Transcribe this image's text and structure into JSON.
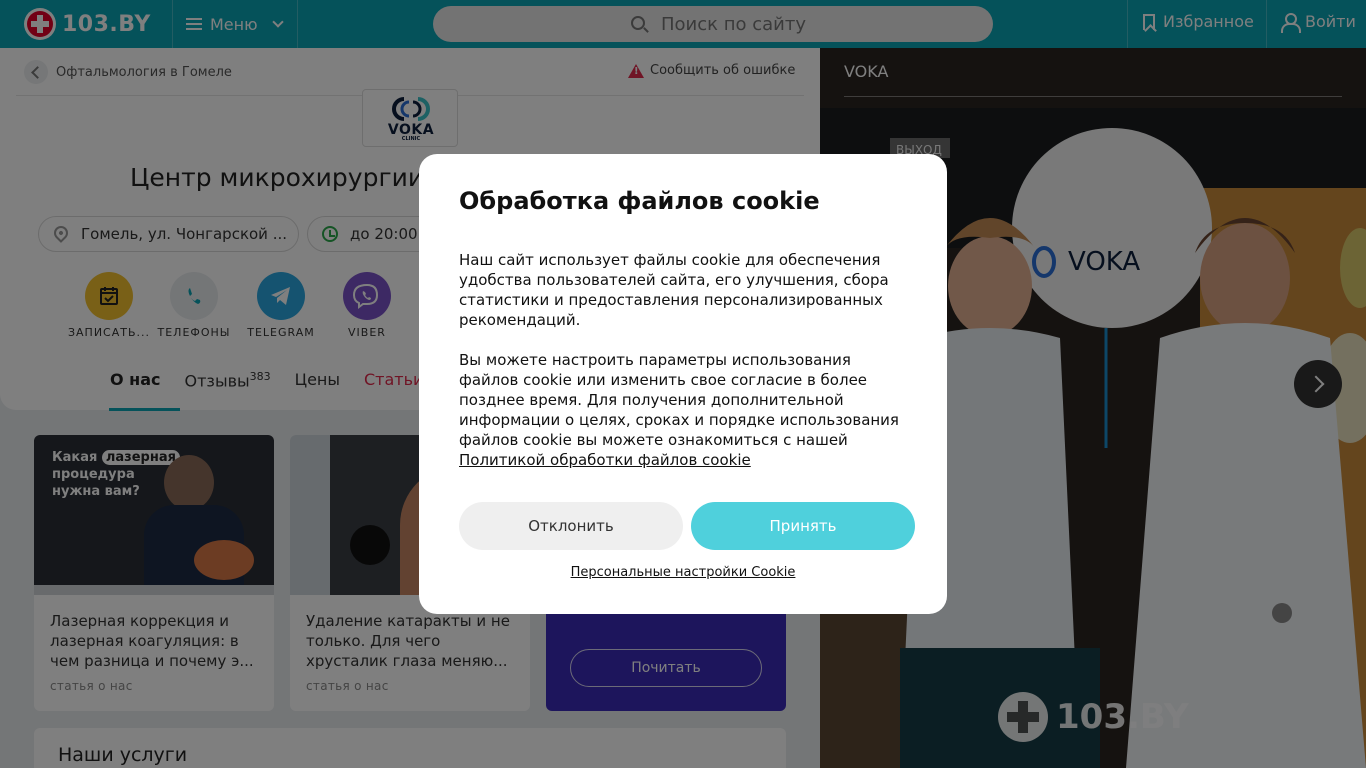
{
  "header": {
    "logo_text": "103.BY",
    "menu_label": "Меню",
    "search_placeholder": "Поиск по сайту",
    "favorites_label": "Избранное",
    "login_label": "Войти",
    "brand_color": "#0aa5b4"
  },
  "breadcrumb": {
    "back_label": "Офтальмология в Гомеле",
    "report_label": "Сообщить об ошибке"
  },
  "clinic": {
    "logo_text": "VOKA",
    "logo_sub": "CLINIC",
    "title": "Центр микрохирургии",
    "address": "Гомель, ул. Чонгарской ...",
    "hours": "до 20:00"
  },
  "actions": [
    {
      "label": "ЗАПИСАТЬ...",
      "icon": "calendar-icon",
      "color": "#f2c12e"
    },
    {
      "label": "ТЕЛЕФОНЫ",
      "icon": "phone-icon",
      "color": "#e8ecef"
    },
    {
      "label": "TELEGRAM",
      "icon": "telegram-icon",
      "color": "#2aa7e0"
    },
    {
      "label": "VIBER",
      "icon": "viber-icon",
      "color": "#7b52c9"
    }
  ],
  "tabs": [
    {
      "label": "О нас",
      "active": true
    },
    {
      "label": "Отзывы",
      "badge": "383"
    },
    {
      "label": "Цены"
    },
    {
      "label": "Статьи"
    }
  ],
  "articles": [
    {
      "title": "Лазерная коррекция и лазерная коагуляция: в чем разница и почему э...",
      "tag": "статья о нас",
      "image_caption_1": "Какая",
      "image_caption_highlight": "лазерная",
      "image_caption_2": "процедура нужна вам?"
    },
    {
      "title": "Удаление катаракты и не только. Для чего хрусталик глаза меняю...",
      "tag": "статья о нас"
    },
    {
      "button": "Почитать"
    }
  ],
  "services_title": "Наши услуги",
  "photo": {
    "title": "VOKA",
    "balloon_text": "VOKA",
    "watermark": "103.BY",
    "exit_sign": "ВЫХОД"
  },
  "cookie_modal": {
    "title": "Обработка файлов cookie",
    "paragraph1": "Наш сайт использует файлы cookie для обеспечения удобства пользователей сайта, его улучшения, сбора статистики и предоставления персонализированных рекомендаций.",
    "paragraph2": "Вы можете настроить параметры использования файлов cookie или изменить свое согласие в более позднее время. Для получения дополнительной информации о целях, сроках и порядке использования файлов cookie вы можете ознакомиться с нашей",
    "policy_link": "Политикой обработки файлов cookie",
    "decline_label": "Отклонить",
    "accept_label": "Принять",
    "settings_link": "Персональные настройки Cookie",
    "accept_color": "#4fd0dc"
  }
}
